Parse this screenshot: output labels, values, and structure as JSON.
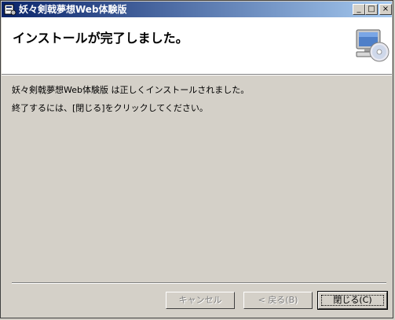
{
  "window": {
    "title": "妖々剣戟夢想Web体験版",
    "controls": {
      "minimize": "_",
      "maximize": "□",
      "close": "×"
    }
  },
  "header": {
    "title": "インストールが完了しました。"
  },
  "body": {
    "line1": "妖々剣戟夢想Web体験版 は正しくインストールされました。",
    "line2": "終了するには、[閉じる]をクリックしてください。"
  },
  "buttons": {
    "cancel": "キャンセル",
    "back": "< 戻る(B)",
    "close": "閉じる(C)"
  },
  "icons": {
    "app": "installer-icon",
    "header": "computer-cd-icon"
  }
}
